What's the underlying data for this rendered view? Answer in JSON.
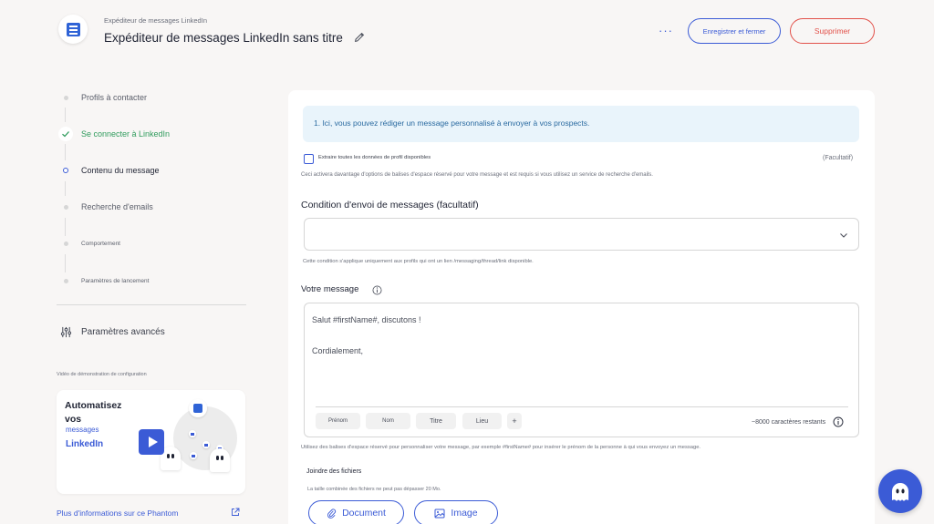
{
  "header": {
    "subtitle": "Expéditeur de messages LinkedIn",
    "title": "Expéditeur de messages LinkedIn sans titre",
    "more": "···",
    "save_label": "Enregistrer et fermer",
    "delete_label": "Supprimer"
  },
  "sidebar": {
    "steps": [
      {
        "label": "Profils à contacter",
        "state": "pending"
      },
      {
        "label": "Se connecter à LinkedIn",
        "state": "done"
      },
      {
        "label": "Contenu du message",
        "state": "current"
      },
      {
        "label": "Recherche d'emails",
        "state": "pending"
      },
      {
        "label": "Comportement",
        "state": "pending"
      },
      {
        "label": "Paramètres de lancement",
        "state": "pending"
      }
    ],
    "advanced_label": "Paramètres avancés",
    "video_label": "Vidéo de démonstration de configuration",
    "video": {
      "line1": "Automatisez",
      "line2": "vos",
      "line3": "messages",
      "line4": "LinkedIn"
    },
    "more_info": "Plus d'informations sur ce Phantom"
  },
  "main": {
    "info": "1. Ici, vous pouvez rédiger un message personnalisé à envoyer à vos prospects.",
    "extract_label": "Extraire toutes les données de profil disponibles",
    "optional": "(Facultatif)",
    "extract_help": "Ceci activera davantage d'options de balises d'espace réservé pour votre message et est requis si vous utilisez un service de recherche d'emails.",
    "condition_title": "Condition d'envoi de messages (facultatif)",
    "condition_value": "",
    "condition_help": "Cette condition s'applique uniquement aux profils qui ont un lien /messaging/thread/link disponible.",
    "message_title": "Votre message",
    "message_line1": "Salut #firstName#, discutons !",
    "message_line2": "Cordialement,",
    "chips": [
      "Prénom",
      "Nom",
      "Titre",
      "Lieu"
    ],
    "plus": "+",
    "chars_left": "~8000 caractères restants",
    "message_help": "Utilisez des balises d'espace réservé pour personnaliser votre message, par exemple #firstName# pour insérer le prénom de la personne à qui vous envoyez un message.",
    "attach_title": "Joindre des fichiers",
    "attach_help": "La taille combinée des fichiers ne peut pas dépasser 20 Mo.",
    "document_label": "Document",
    "image_label": "Image"
  },
  "colors": {
    "accent": "#3b5bd6",
    "danger": "#e2514a",
    "success": "#2f9b5c",
    "info_bg": "#e9f4fb"
  }
}
